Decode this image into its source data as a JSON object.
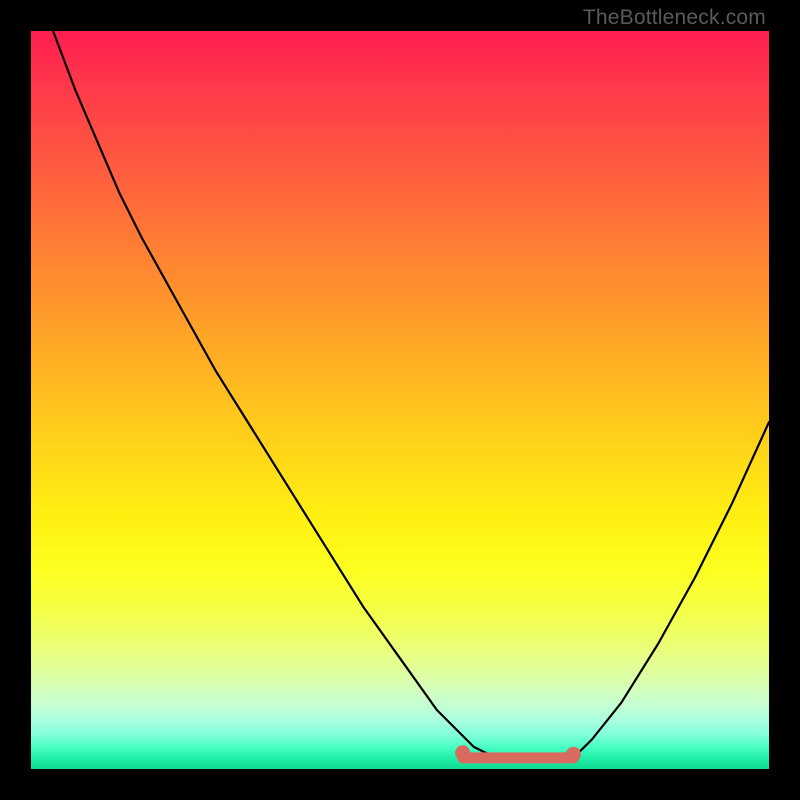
{
  "watermark": "TheBottleneck.com",
  "colors": {
    "frame": "#000000",
    "curve": "#000000",
    "marker": "#d86a5f",
    "gradient_top": "#ff1e50",
    "gradient_bottom": "#10d890"
  },
  "chart_data": {
    "type": "line",
    "title": "",
    "xlabel": "",
    "ylabel": "",
    "xlim": [
      0,
      100
    ],
    "ylim": [
      0,
      100
    ],
    "x": [
      0,
      3,
      6,
      9,
      12,
      15,
      20,
      25,
      30,
      35,
      40,
      45,
      50,
      55,
      58,
      60,
      62,
      64,
      68,
      72,
      74,
      76,
      80,
      85,
      90,
      95,
      100
    ],
    "values": [
      115,
      100,
      92,
      85,
      78,
      72,
      63,
      54,
      46,
      38,
      30,
      22,
      15,
      8,
      5,
      3,
      2,
      1,
      1,
      1,
      2,
      4,
      9,
      17,
      26,
      36,
      47
    ],
    "series": [
      {
        "name": "bottleneck-curve",
        "x": [
          0,
          3,
          6,
          9,
          12,
          15,
          20,
          25,
          30,
          35,
          40,
          45,
          50,
          55,
          58,
          60,
          62,
          64,
          68,
          72,
          74,
          76,
          80,
          85,
          90,
          95,
          100
        ],
        "y": [
          115,
          100,
          92,
          85,
          78,
          72,
          63,
          54,
          46,
          38,
          30,
          22,
          15,
          8,
          5,
          3,
          2,
          1,
          1,
          1,
          2,
          4,
          9,
          17,
          26,
          36,
          47
        ]
      }
    ],
    "annotations": [
      {
        "type": "segment",
        "name": "optimal-range",
        "x0": 58.5,
        "x1": 73.5,
        "y": 1.5,
        "color": "#d86a5f"
      },
      {
        "type": "point",
        "name": "optimal-start-dot",
        "x": 58.5,
        "y": 2.2,
        "color": "#d86a5f"
      },
      {
        "type": "point",
        "name": "optimal-end-dot",
        "x": 73.5,
        "y": 2.0,
        "color": "#d86a5f"
      }
    ]
  }
}
